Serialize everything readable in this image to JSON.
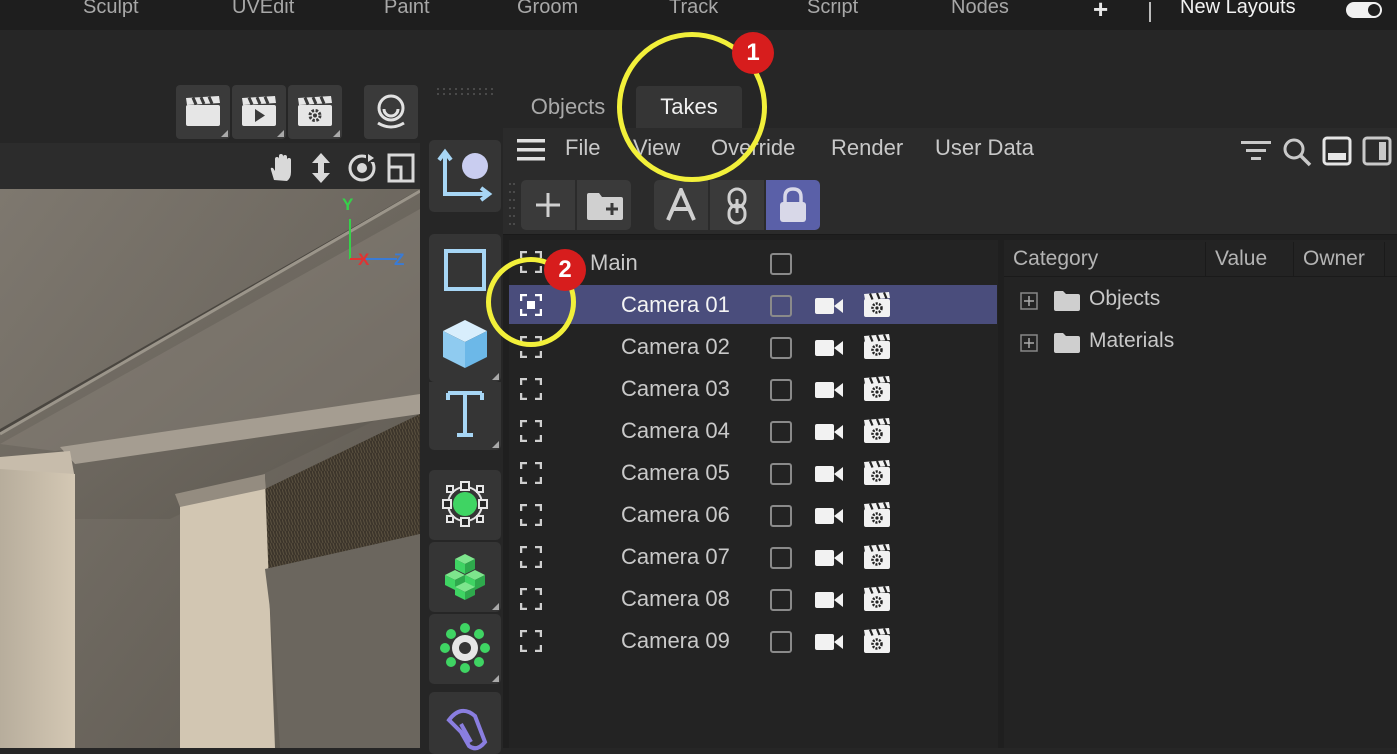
{
  "layout_bar": {
    "tabs": [
      "Sculpt",
      "UVEdit",
      "Paint",
      "Groom",
      "Track",
      "Script",
      "Nodes"
    ],
    "add_label": "+",
    "new_layouts_label": "New Layouts",
    "toggle_on": true
  },
  "viewport": {
    "axis_labels": {
      "y": "Y",
      "x": "X",
      "z": "Z"
    }
  },
  "panel": {
    "tabs": [
      "Objects",
      "Takes"
    ],
    "active_tab": "Takes",
    "menu": [
      "File",
      "View",
      "Override",
      "Render",
      "User Data"
    ],
    "tree": {
      "root": "Main",
      "selected": "Camera 01",
      "takes": [
        "Camera 01",
        "Camera 02",
        "Camera 03",
        "Camera 04",
        "Camera 05",
        "Camera 06",
        "Camera 07",
        "Camera 08",
        "Camera 09"
      ]
    },
    "attributes": {
      "columns": [
        "Category",
        "Value",
        "Owner"
      ],
      "rows": [
        "Objects",
        "Materials"
      ]
    }
  },
  "annotations": {
    "badge_1": "1",
    "badge_2": "2",
    "ring_color": "#f2f03a",
    "badge_color": "#d71d1d"
  },
  "colors": {
    "accent_blue": "#a7d6f5",
    "selection": "#4a4d7c",
    "green_tool": "#3fd463"
  }
}
